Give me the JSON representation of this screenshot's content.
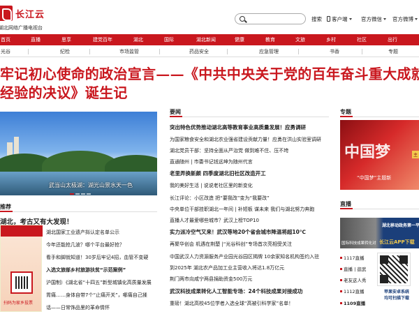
{
  "brand": {
    "name": "长江云",
    "subtitle": "湖北网络广播电视台"
  },
  "search": {
    "placeholder": "",
    "button": "搜索"
  },
  "tools": {
    "client": "客户端",
    "wechat": "官方微信",
    "weibo": "官方微博"
  },
  "nav": [
    "首页",
    "直播",
    "思享",
    "建党百年",
    "湖北",
    "国际",
    "湖北新闻",
    "健康",
    "教育",
    "文旅",
    "乡村",
    "社区",
    "出行"
  ],
  "subnav": [
    "光谷",
    "纪检",
    "市场监管",
    "药品安全",
    "应急管理",
    "书香",
    "专题"
  ],
  "headline": {
    "line1": "牢记初心使命的政治宣言——《中共中央关于党的百年奋斗重大成就和",
    "line2": "经验的决议》诞生记"
  },
  "slider": {
    "caption": "武当山太极湖：湖光山景水天一色"
  },
  "sections": {
    "news": "要闻",
    "topic": "专题",
    "recommend": "推荐",
    "live": "直播"
  },
  "left": {
    "promo_title": "湖北，考古又有大发现！",
    "poster_foot": "扫码为家乡投票",
    "items": [
      "湖北国家工业遗产拟认定名单公示",
      "今年还能抢几波？哪个平台最好抢？",
      "看手和脚就知道！30岁后牢记4招，血管不变硬",
      "入选文旅部乡村旅游扶贫“示范案例”",
      "沪国制）《湖北省“十四五”新型城镇化高质量发展",
      "胃痛……身体自带7个“止痛开关”，哪痛自己揉",
      "话——日常饰品里的革命情怀"
    ]
  },
  "news": [
    {
      "text": "突出特色优势推动湖北高等教育事业高质量发展！应勇调研",
      "bold": true
    },
    {
      "text": "为国家粮食安全和湖北农业强省建设贡献力量！应勇在洪山实验室调研",
      "bold": false
    },
    {
      "text": "湖北党员干部：坚持全面从严治党 做到难不住、压不垮",
      "bold": false
    },
    {
      "text": "直通随州 | 市委书记钱远坤为随州代言",
      "bold": false
    },
    {
      "text": "老里弄换新颜 四季度湖北旧社区改造开工",
      "bold": true
    },
    {
      "text": "我的美好生活 | 说说老社区里的新变化",
      "bold": false
    },
    {
      "text": "长江评论：小区改造 把“要我改”变为“我要改”",
      "bold": false
    },
    {
      "text": "中央单位干部挂职湖北一年间 | 补短板 谋未来 我们与湖北努力奔跑",
      "bold": false
    },
    {
      "text": "直播人才最爱哪些城市？武汉上榜TOP10",
      "bold": false
    },
    {
      "text": "实力派冷空气又来！武汉等地20个省会城市降温将超10℃",
      "bold": true
    },
    {
      "text": "再聚华创会 机遇在荆楚 |“光谷科创”专场首次亮相受关注",
      "bold": false
    },
    {
      "text": "中国武汉人力资源服务产业园光谷园区揭牌 10余家知名机构签约入驻",
      "bold": false
    },
    {
      "text": "到2025年 湖北农产品加工业主营收入将达1.8万亿元",
      "bold": false
    },
    {
      "text": "荆门两市向咸宁两县捐助资金500万元",
      "bold": false
    },
    {
      "text": "武汉科技成果转化人工智能专场：24个科技成果对接成功",
      "bold": true
    },
    {
      "text": "重磅！湖北高校45位学者入选全球“高被引科学家”名单！",
      "bold": false
    }
  ],
  "right": {
    "banner_big": "中国梦",
    "banner_small": "“中国梦”主题新",
    "banner_tag": "主",
    "live_thumb_left": "国际科技成果转化对",
    "live_thumb_r1": "湖北移动政务第一平",
    "live_thumb_r2": "长江云APP下载",
    "live_items": [
      "1117直播",
      "直播 | 逛武",
      "老友这人秀",
      "1112直播",
      "1109直播"
    ],
    "qr_caption1": "苹果安卓系统",
    "qr_caption2": "均可扫描下载"
  }
}
